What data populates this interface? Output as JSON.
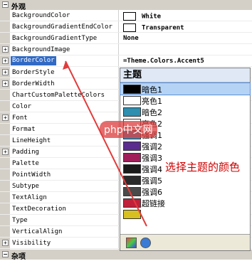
{
  "grid": {
    "category_top": "外观",
    "rows": [
      {
        "name": "BackgroundColor",
        "value": "White",
        "swatch": "#ffffff",
        "expand": false
      },
      {
        "name": "BackgroundGradientEndColor",
        "value": "Transparent",
        "swatch": "#ffffff",
        "expand": false
      },
      {
        "name": "BackgroundGradientType",
        "value": "None",
        "expand": false
      },
      {
        "name": "BackgroundImage",
        "value": "",
        "expand": true
      },
      {
        "name": "BorderColor",
        "value": "=Theme.Colors.Accent5",
        "expand": true,
        "selected": true
      },
      {
        "name": "BorderStyle",
        "value": "",
        "expand": true
      },
      {
        "name": "BorderWidth",
        "value": "",
        "expand": true
      },
      {
        "name": "ChartCustomPaletteColors",
        "value": "",
        "expand": false
      },
      {
        "name": "Color",
        "value": "",
        "expand": false
      },
      {
        "name": "Font",
        "value": "",
        "expand": true
      },
      {
        "name": "Format",
        "value": "",
        "expand": false
      },
      {
        "name": "LineHeight",
        "value": "",
        "expand": false
      },
      {
        "name": "Padding",
        "value": "",
        "expand": true
      },
      {
        "name": "Palette",
        "value": "",
        "expand": false
      },
      {
        "name": "PointWidth",
        "value": "",
        "expand": false
      },
      {
        "name": "Subtype",
        "value": "",
        "expand": false
      },
      {
        "name": "TextAlign",
        "value": "",
        "expand": false
      },
      {
        "name": "TextDecoration",
        "value": "",
        "expand": false
      },
      {
        "name": "Type",
        "value": "",
        "expand": false
      },
      {
        "name": "VerticalAlign",
        "value": "",
        "expand": false
      },
      {
        "name": "Visibility",
        "value": "",
        "expand": true
      }
    ],
    "category_bottom": "杂项"
  },
  "dropdown": {
    "title": "主题",
    "items": [
      {
        "label": "暗色1",
        "color": "#000000",
        "selected": true
      },
      {
        "label": "亮色1",
        "color": "#ffffff"
      },
      {
        "label": "暗色2",
        "color": "#2e8fb0"
      },
      {
        "label": "亮色2",
        "color": "#ffffff"
      },
      {
        "label": "强调1",
        "color": "#3b8fc0"
      },
      {
        "label": "强调2",
        "color": "#5b2d8e"
      },
      {
        "label": "强调3",
        "color": "#a01f5a"
      },
      {
        "label": "强调4",
        "color": "#1a1a1a"
      },
      {
        "label": "强调5",
        "color": "#2a2a2a"
      },
      {
        "label": "强调6",
        "color": "#4a4a4a"
      },
      {
        "label": "超链接",
        "color": "#c0203a"
      },
      {
        "label": "",
        "color": "#d8c020"
      }
    ]
  },
  "annotation": "选择主题的颜色",
  "watermark": "php中文网"
}
